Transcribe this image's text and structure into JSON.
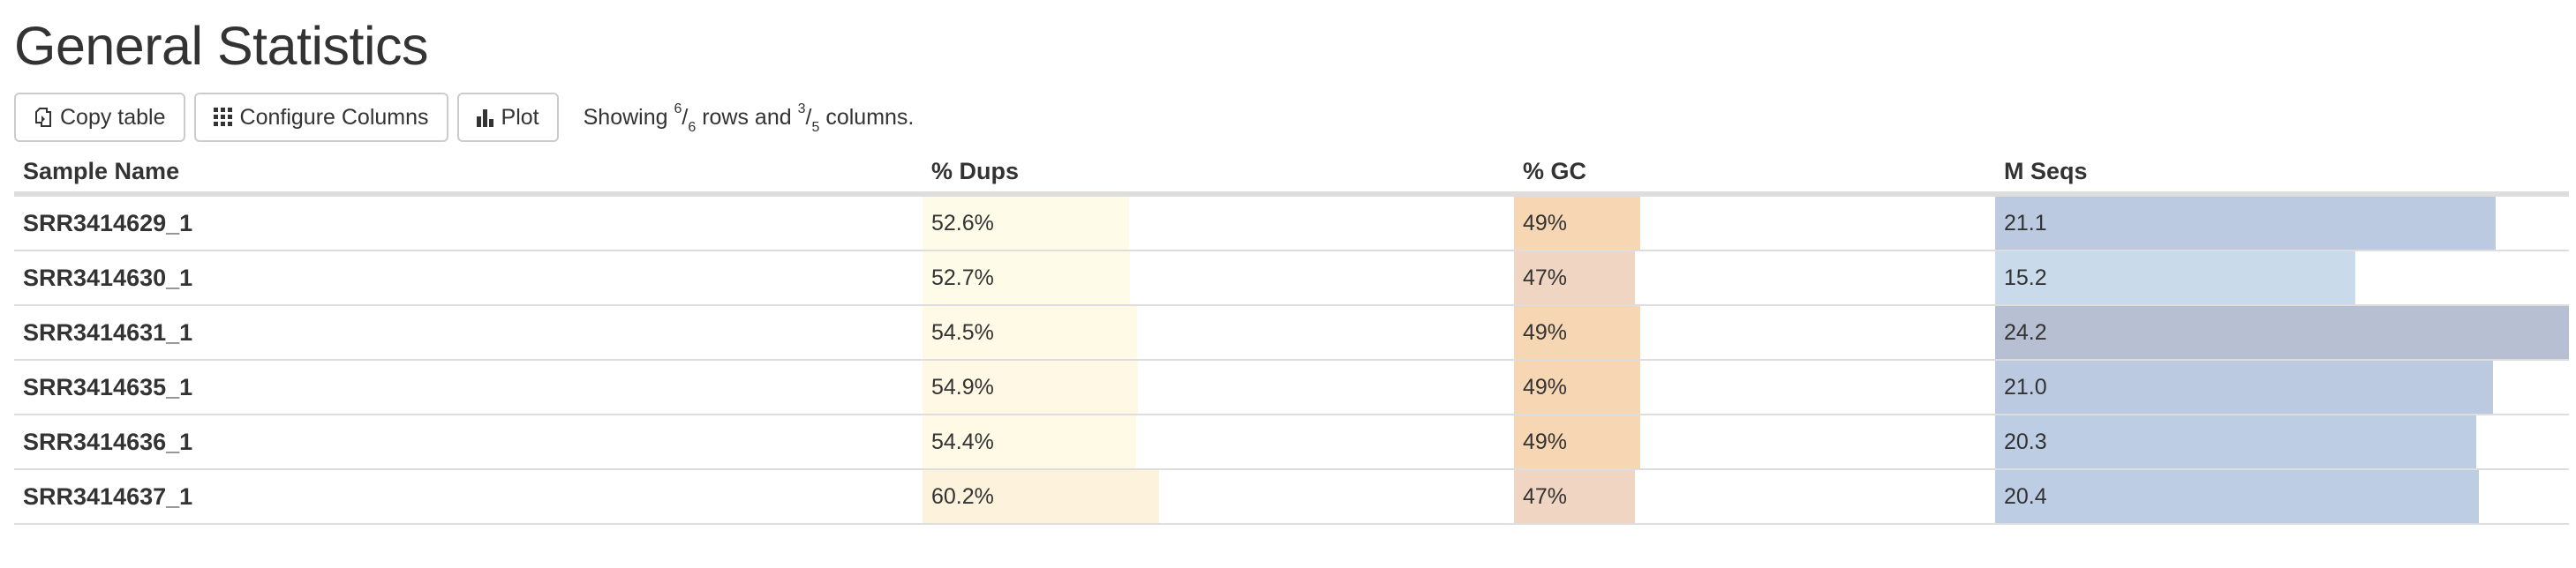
{
  "page": {
    "title": "General Statistics"
  },
  "toolbar": {
    "copy_label": "Copy table",
    "configure_label": "Configure Columns",
    "plot_label": "Plot",
    "status_prefix": "Showing",
    "rows_shown": "6",
    "rows_total": "6",
    "rows_word": "rows and",
    "cols_shown": "3",
    "cols_total": "5",
    "cols_word": "columns."
  },
  "table": {
    "columns": [
      {
        "label": "Sample Name"
      },
      {
        "label": "% Dups"
      },
      {
        "label": "% GC"
      },
      {
        "label": "M Seqs"
      }
    ],
    "rows": [
      {
        "name": "SRR3414629_1",
        "dups": "52.6%",
        "dups_frac": 0.526,
        "gc": "49%",
        "gc_frac": 0.49,
        "seqs": "21.1",
        "seqs_frac": 0.872
      },
      {
        "name": "SRR3414630_1",
        "dups": "52.7%",
        "dups_frac": 0.527,
        "gc": "47%",
        "gc_frac": 0.47,
        "seqs": "15.2",
        "seqs_frac": 0.628
      },
      {
        "name": "SRR3414631_1",
        "dups": "54.5%",
        "dups_frac": 0.545,
        "gc": "49%",
        "gc_frac": 0.49,
        "seqs": "24.2",
        "seqs_frac": 1.0
      },
      {
        "name": "SRR3414635_1",
        "dups": "54.9%",
        "dups_frac": 0.549,
        "gc": "49%",
        "gc_frac": 0.49,
        "seqs": "21.0",
        "seqs_frac": 0.868
      },
      {
        "name": "SRR3414636_1",
        "dups": "54.4%",
        "dups_frac": 0.544,
        "gc": "49%",
        "gc_frac": 0.49,
        "seqs": "20.3",
        "seqs_frac": 0.839
      },
      {
        "name": "SRR3414637_1",
        "dups": "60.2%",
        "dups_frac": 0.602,
        "gc": "47%",
        "gc_frac": 0.47,
        "seqs": "20.4",
        "seqs_frac": 0.843
      }
    ]
  },
  "colors": {
    "dups_bars": [
      "#fefce9",
      "#fefce9",
      "#fefae6",
      "#fef8e4",
      "#fefae6",
      "#fdf3dc"
    ],
    "gc_bars": [
      "#f7d6b4",
      "#f0d6c2",
      "#f7d6b4",
      "#f7d6b4",
      "#f7d6b4",
      "#f0d6c2"
    ],
    "seqs_bars": [
      "#bbcae0",
      "#c9dbeb",
      "#b7c0d2",
      "#bbcae0",
      "#bdcde3",
      "#bdcde3"
    ]
  }
}
